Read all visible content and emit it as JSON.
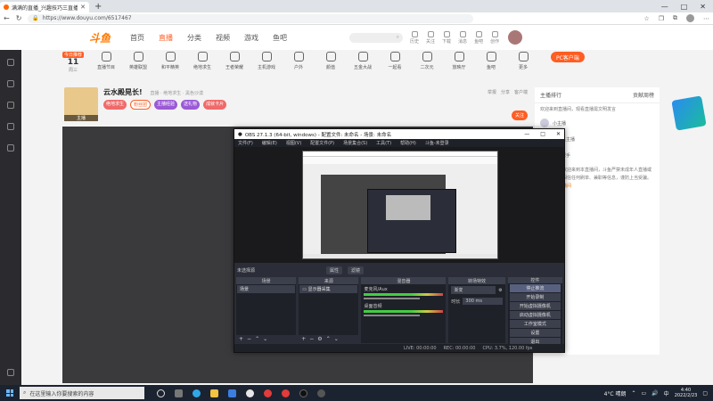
{
  "browser": {
    "tab_title": "满满的直播_兴趣技巧三直播_斗鱼",
    "url": "https://www.douyu.com/6517467",
    "win_min": "—",
    "win_max": "□",
    "win_close": "✕"
  },
  "header": {
    "logo": "斗鱼",
    "nav": [
      "首页",
      "直播",
      "分类",
      "视频",
      "游戏",
      "鱼吧"
    ],
    "icons": [
      "历史",
      "关注",
      "下载",
      "消息",
      "鱼吧",
      "创作"
    ]
  },
  "calendar": {
    "badge": "今日推荐",
    "day": "11",
    "week": "周三"
  },
  "categories": [
    "直播节目",
    "英雄联盟",
    "和平精英",
    "绝地求生",
    "王者荣耀",
    "主机游戏",
    "户外",
    "颜值",
    "五金大战",
    "一起看",
    "二次元",
    "放映厅",
    "鱼吧",
    "更多"
  ],
  "pc_button": "PC客户端",
  "anchor": {
    "title": "云水殿晃长!",
    "meta": "直播 · 绝地求生 · 黑色沙漠",
    "level": "主播",
    "tags": [
      "绝地求生",
      "粉丝团",
      "主播经验",
      "送礼物",
      "成就卡片"
    ],
    "right": [
      "举报",
      "分享",
      "客户端"
    ],
    "follow": "关注"
  },
  "right_panel": {
    "tabs": [
      "主播排行",
      "贡献周榜"
    ],
    "notice": "欢迎来到直播间，观看直播需文明发言",
    "ranks": [
      "小主播",
      "不知名主播",
      "鱼丸帮手"
    ],
    "chat": "系统提示：欢迎来到本直播间，斗鱼严禁未成年人直播或打赏，请勿相信任何刷单、兼职等信息，谨防上当受骗。",
    "chat_sys": "欢迎来到直播间"
  },
  "obs": {
    "title": "OBS 27.1.3 (64-bit, windows) - 配置文件: 未命名 - 场景: 未命名",
    "menu": [
      "文件(F)",
      "编辑(E)",
      "视图(V)",
      "配置文件(P)",
      "场景集合(S)",
      "工具(T)",
      "帮助(H)",
      "斗鱼-未登录"
    ],
    "scenebar_label": "未选择源",
    "scenebar_btns": [
      "属性",
      "滤镜"
    ],
    "docks": {
      "scenes": {
        "title": "场景",
        "items": [
          "场景"
        ]
      },
      "sources": {
        "title": "来源",
        "items": [
          "显示器采集"
        ]
      },
      "mixer": {
        "title": "混音器",
        "rows": [
          "麦克风/Aux",
          "桌面音频"
        ]
      },
      "transitions": {
        "title": "转场特效",
        "select": "渐变",
        "duration_label": "时长",
        "duration": "300 ms"
      },
      "controls": {
        "title": "控件",
        "buttons": [
          "停止推流",
          "开始录制",
          "开始虚拟摄像机",
          "启动虚拟摄像机",
          "工作室模式",
          "设置",
          "退出"
        ]
      }
    },
    "status": [
      "LIVE: 00:00:00",
      "REC: 00:00:00",
      "CPU: 3.7%, 120.00 fps"
    ]
  },
  "taskbar": {
    "search_placeholder": "在这里输入你要搜索的内容",
    "weather": "4°C 晴朗",
    "lang": "中",
    "time": "4:40",
    "date": "2022/2/23"
  },
  "colors": {
    "accent": "#ff5d23",
    "obs_bg": "#2b2e38"
  }
}
